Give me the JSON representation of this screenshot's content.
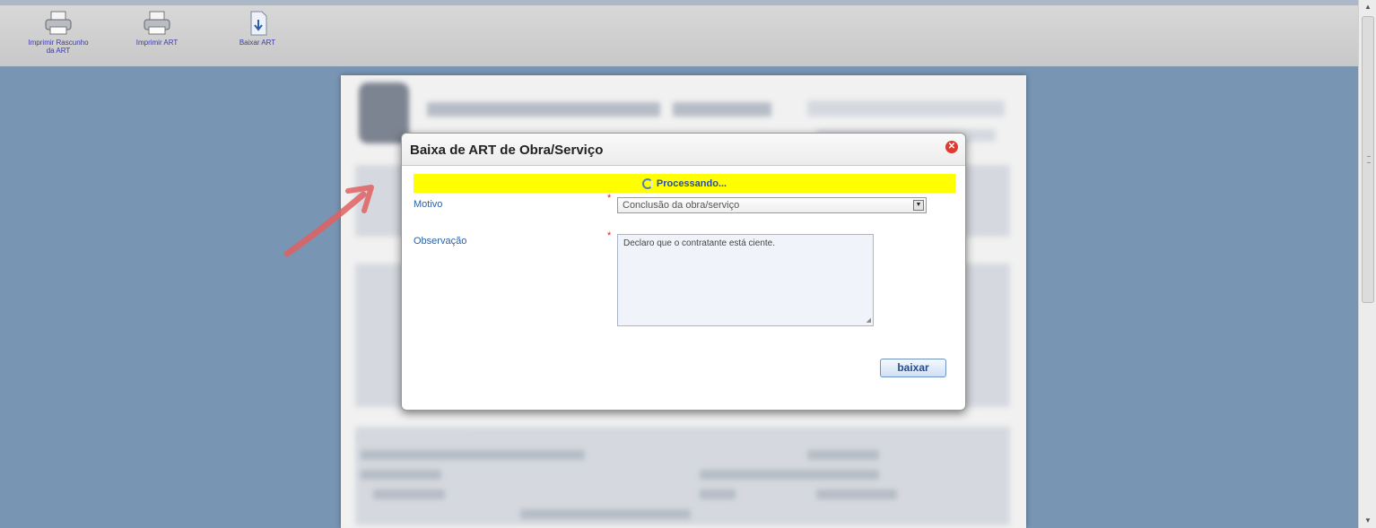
{
  "toolbar": {
    "items": [
      {
        "label": "Imprimir Rascunho da ART",
        "icon": "printer-icon"
      },
      {
        "label": "Imprimir ART",
        "icon": "printer-icon"
      },
      {
        "label": "Baixar ART",
        "icon": "document-download-icon"
      }
    ]
  },
  "dialog": {
    "title": "Baixa de ART de Obra/Serviço",
    "status": "Processando...",
    "fields": {
      "motivo_label": "Motivo",
      "motivo_value": "Conclusão da obra/serviço",
      "observacao_label": "Observação",
      "observacao_value": "Declaro que o contratante está ciente.",
      "required_mark": "*"
    },
    "submit_label": "baixar"
  },
  "colors": {
    "processing_bg": "#ffff00",
    "desk_bg": "#7895b4",
    "annotation_arrow": "#e06060"
  }
}
